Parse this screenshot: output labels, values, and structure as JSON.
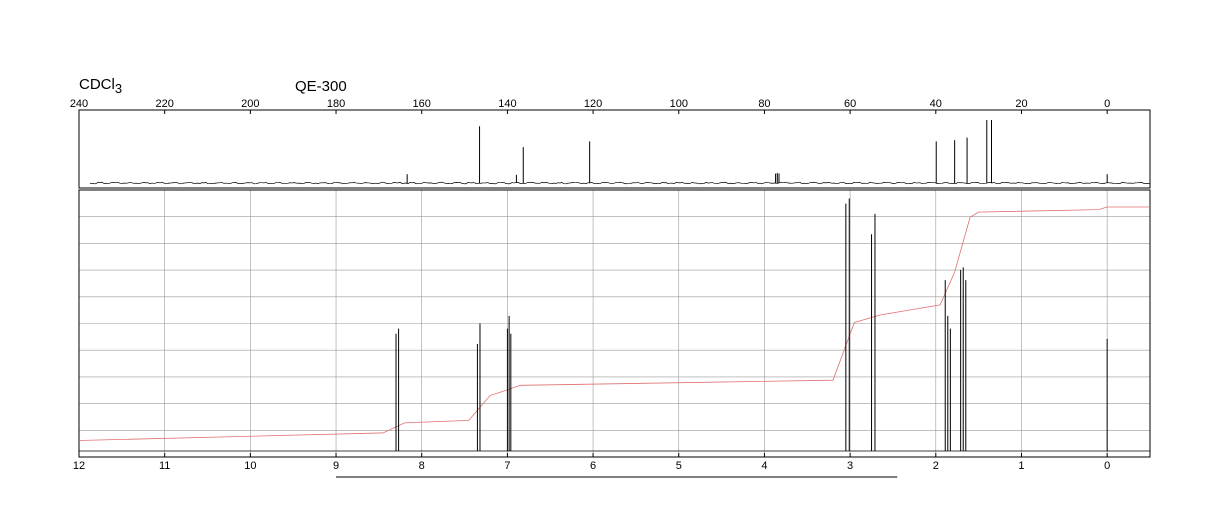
{
  "solvent": {
    "main": "CDCl",
    "sub": "3"
  },
  "instrument": "QE-300",
  "chart_data": [
    {
      "type": "line",
      "title": "",
      "spectrum": "13C NMR",
      "xlabel": "",
      "ylabel": "",
      "xlim": [
        240,
        -10
      ],
      "x_reversed": true,
      "xticks": [
        "240",
        "220",
        "200",
        "180",
        "160",
        "140",
        "120",
        "100",
        "80",
        "60",
        "40",
        "20",
        "0"
      ],
      "grid": false,
      "peaks": [
        {
          "ppm": 163.4,
          "intensity": 0.14
        },
        {
          "ppm": 146.5,
          "intensity": 0.9
        },
        {
          "ppm": 137.9,
          "intensity": 0.13
        },
        {
          "ppm": 136.3,
          "intensity": 0.57
        },
        {
          "ppm": 120.8,
          "intensity": 0.66
        },
        {
          "ppm": 77.4,
          "intensity": 0.15
        },
        {
          "ppm": 77.0,
          "intensity": 0.16
        },
        {
          "ppm": 76.6,
          "intensity": 0.15
        },
        {
          "ppm": 39.9,
          "intensity": 0.66
        },
        {
          "ppm": 35.6,
          "intensity": 0.68
        },
        {
          "ppm": 32.7,
          "intensity": 0.72
        },
        {
          "ppm": 28.1,
          "intensity": 1.0
        },
        {
          "ppm": 27.0,
          "intensity": 1.0
        },
        {
          "ppm": 0.0,
          "intensity": 0.14
        }
      ]
    },
    {
      "type": "line",
      "title": "",
      "spectrum": "1H NMR",
      "xlabel": "",
      "ylabel": "",
      "xlim": [
        12,
        -0.5
      ],
      "x_reversed": true,
      "xticks": [
        "12",
        "11",
        "10",
        "9",
        "8",
        "7",
        "6",
        "5",
        "4",
        "3",
        "2",
        "1",
        "0"
      ],
      "grid": true,
      "series": [
        {
          "role": "spectrum",
          "color": "#000000",
          "peaks": [
            {
              "ppm": 8.3,
              "intensity": 0.46
            },
            {
              "ppm": 8.27,
              "intensity": 0.48
            },
            {
              "ppm": 7.35,
              "intensity": 0.42
            },
            {
              "ppm": 7.32,
              "intensity": 0.5
            },
            {
              "ppm": 7.0,
              "intensity": 0.48
            },
            {
              "ppm": 6.98,
              "intensity": 0.53
            },
            {
              "ppm": 6.96,
              "intensity": 0.46
            },
            {
              "ppm": 3.05,
              "intensity": 0.97
            },
            {
              "ppm": 3.01,
              "intensity": 0.99
            },
            {
              "ppm": 2.75,
              "intensity": 0.85
            },
            {
              "ppm": 2.71,
              "intensity": 0.93
            },
            {
              "ppm": 1.89,
              "intensity": 0.67
            },
            {
              "ppm": 1.86,
              "intensity": 0.53
            },
            {
              "ppm": 1.83,
              "intensity": 0.48
            },
            {
              "ppm": 1.71,
              "intensity": 0.71
            },
            {
              "ppm": 1.68,
              "intensity": 0.72
            },
            {
              "ppm": 1.65,
              "intensity": 0.67
            },
            {
              "ppm": 0.0,
              "intensity": 0.44
            }
          ]
        },
        {
          "role": "integral",
          "color": "#e07070",
          "points": [
            [
              12.0,
              0.03
            ],
            [
              8.45,
              0.06
            ],
            [
              8.2,
              0.1
            ],
            [
              7.45,
              0.11
            ],
            [
              7.2,
              0.21
            ],
            [
              7.1,
              0.22
            ],
            [
              6.85,
              0.25
            ],
            [
              3.2,
              0.27
            ],
            [
              2.95,
              0.5
            ],
            [
              2.85,
              0.51
            ],
            [
              2.65,
              0.53
            ],
            [
              1.95,
              0.57
            ],
            [
              1.78,
              0.7
            ],
            [
              1.6,
              0.92
            ],
            [
              1.5,
              0.94
            ],
            [
              0.1,
              0.95
            ],
            [
              0.0,
              0.96
            ],
            [
              -0.5,
              0.96
            ]
          ]
        }
      ]
    }
  ]
}
